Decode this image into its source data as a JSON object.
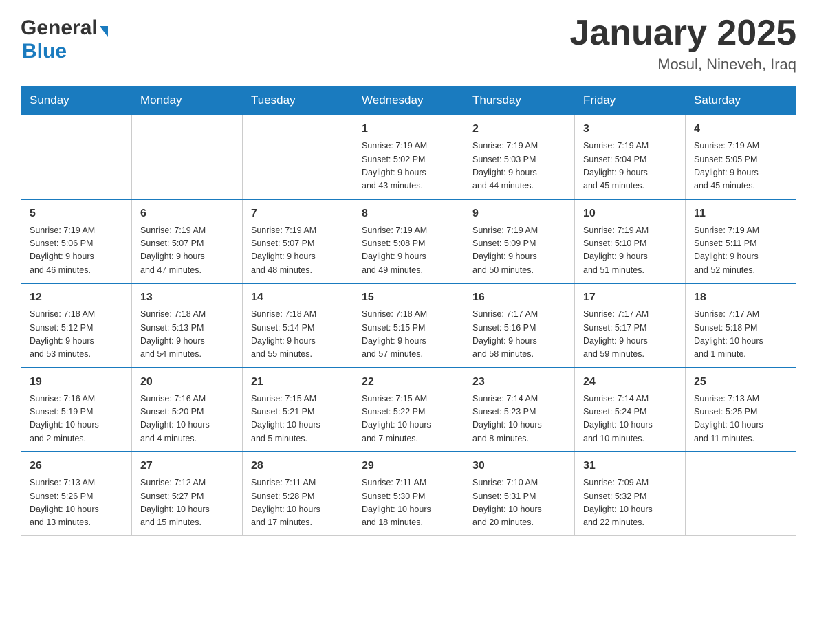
{
  "header": {
    "logo_general": "General",
    "logo_blue": "Blue",
    "month_title": "January 2025",
    "location": "Mosul, Nineveh, Iraq"
  },
  "days_of_week": [
    "Sunday",
    "Monday",
    "Tuesday",
    "Wednesday",
    "Thursday",
    "Friday",
    "Saturday"
  ],
  "weeks": [
    [
      {
        "day": "",
        "info": ""
      },
      {
        "day": "",
        "info": ""
      },
      {
        "day": "",
        "info": ""
      },
      {
        "day": "1",
        "info": "Sunrise: 7:19 AM\nSunset: 5:02 PM\nDaylight: 9 hours\nand 43 minutes."
      },
      {
        "day": "2",
        "info": "Sunrise: 7:19 AM\nSunset: 5:03 PM\nDaylight: 9 hours\nand 44 minutes."
      },
      {
        "day": "3",
        "info": "Sunrise: 7:19 AM\nSunset: 5:04 PM\nDaylight: 9 hours\nand 45 minutes."
      },
      {
        "day": "4",
        "info": "Sunrise: 7:19 AM\nSunset: 5:05 PM\nDaylight: 9 hours\nand 45 minutes."
      }
    ],
    [
      {
        "day": "5",
        "info": "Sunrise: 7:19 AM\nSunset: 5:06 PM\nDaylight: 9 hours\nand 46 minutes."
      },
      {
        "day": "6",
        "info": "Sunrise: 7:19 AM\nSunset: 5:07 PM\nDaylight: 9 hours\nand 47 minutes."
      },
      {
        "day": "7",
        "info": "Sunrise: 7:19 AM\nSunset: 5:07 PM\nDaylight: 9 hours\nand 48 minutes."
      },
      {
        "day": "8",
        "info": "Sunrise: 7:19 AM\nSunset: 5:08 PM\nDaylight: 9 hours\nand 49 minutes."
      },
      {
        "day": "9",
        "info": "Sunrise: 7:19 AM\nSunset: 5:09 PM\nDaylight: 9 hours\nand 50 minutes."
      },
      {
        "day": "10",
        "info": "Sunrise: 7:19 AM\nSunset: 5:10 PM\nDaylight: 9 hours\nand 51 minutes."
      },
      {
        "day": "11",
        "info": "Sunrise: 7:19 AM\nSunset: 5:11 PM\nDaylight: 9 hours\nand 52 minutes."
      }
    ],
    [
      {
        "day": "12",
        "info": "Sunrise: 7:18 AM\nSunset: 5:12 PM\nDaylight: 9 hours\nand 53 minutes."
      },
      {
        "day": "13",
        "info": "Sunrise: 7:18 AM\nSunset: 5:13 PM\nDaylight: 9 hours\nand 54 minutes."
      },
      {
        "day": "14",
        "info": "Sunrise: 7:18 AM\nSunset: 5:14 PM\nDaylight: 9 hours\nand 55 minutes."
      },
      {
        "day": "15",
        "info": "Sunrise: 7:18 AM\nSunset: 5:15 PM\nDaylight: 9 hours\nand 57 minutes."
      },
      {
        "day": "16",
        "info": "Sunrise: 7:17 AM\nSunset: 5:16 PM\nDaylight: 9 hours\nand 58 minutes."
      },
      {
        "day": "17",
        "info": "Sunrise: 7:17 AM\nSunset: 5:17 PM\nDaylight: 9 hours\nand 59 minutes."
      },
      {
        "day": "18",
        "info": "Sunrise: 7:17 AM\nSunset: 5:18 PM\nDaylight: 10 hours\nand 1 minute."
      }
    ],
    [
      {
        "day": "19",
        "info": "Sunrise: 7:16 AM\nSunset: 5:19 PM\nDaylight: 10 hours\nand 2 minutes."
      },
      {
        "day": "20",
        "info": "Sunrise: 7:16 AM\nSunset: 5:20 PM\nDaylight: 10 hours\nand 4 minutes."
      },
      {
        "day": "21",
        "info": "Sunrise: 7:15 AM\nSunset: 5:21 PM\nDaylight: 10 hours\nand 5 minutes."
      },
      {
        "day": "22",
        "info": "Sunrise: 7:15 AM\nSunset: 5:22 PM\nDaylight: 10 hours\nand 7 minutes."
      },
      {
        "day": "23",
        "info": "Sunrise: 7:14 AM\nSunset: 5:23 PM\nDaylight: 10 hours\nand 8 minutes."
      },
      {
        "day": "24",
        "info": "Sunrise: 7:14 AM\nSunset: 5:24 PM\nDaylight: 10 hours\nand 10 minutes."
      },
      {
        "day": "25",
        "info": "Sunrise: 7:13 AM\nSunset: 5:25 PM\nDaylight: 10 hours\nand 11 minutes."
      }
    ],
    [
      {
        "day": "26",
        "info": "Sunrise: 7:13 AM\nSunset: 5:26 PM\nDaylight: 10 hours\nand 13 minutes."
      },
      {
        "day": "27",
        "info": "Sunrise: 7:12 AM\nSunset: 5:27 PM\nDaylight: 10 hours\nand 15 minutes."
      },
      {
        "day": "28",
        "info": "Sunrise: 7:11 AM\nSunset: 5:28 PM\nDaylight: 10 hours\nand 17 minutes."
      },
      {
        "day": "29",
        "info": "Sunrise: 7:11 AM\nSunset: 5:30 PM\nDaylight: 10 hours\nand 18 minutes."
      },
      {
        "day": "30",
        "info": "Sunrise: 7:10 AM\nSunset: 5:31 PM\nDaylight: 10 hours\nand 20 minutes."
      },
      {
        "day": "31",
        "info": "Sunrise: 7:09 AM\nSunset: 5:32 PM\nDaylight: 10 hours\nand 22 minutes."
      },
      {
        "day": "",
        "info": ""
      }
    ]
  ]
}
